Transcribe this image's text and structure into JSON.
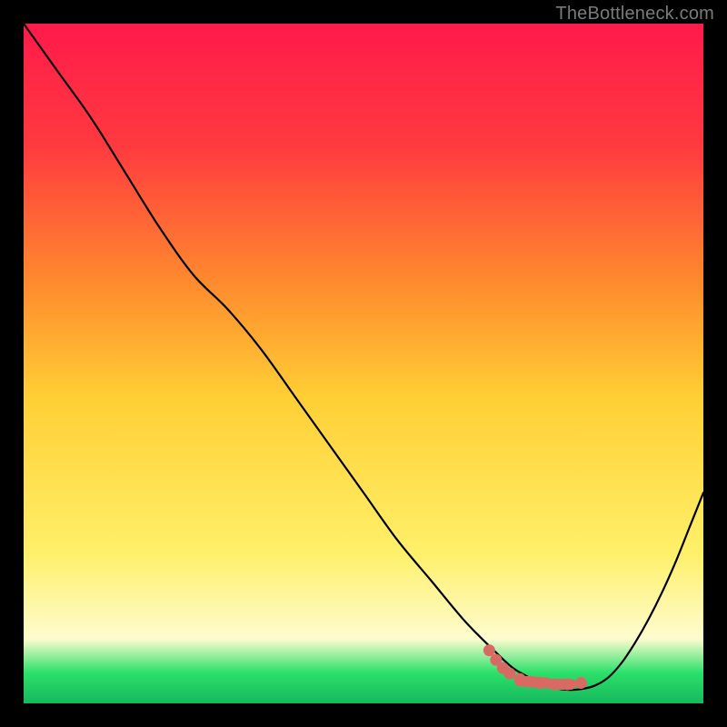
{
  "watermark": "TheBottleneck.com",
  "colors": {
    "grad_top": "#ff1a4b",
    "grad_mid_upper": "#ff7a33",
    "grad_mid": "#ffd23a",
    "grad_mid_lower": "#fff06a",
    "grad_band_pale": "#fefccf",
    "grad_band_green": "#2ce06a",
    "curve": "#000000",
    "marker": "#d86a63",
    "border": "#000000"
  },
  "chart_data": {
    "type": "line",
    "title": "",
    "xlabel": "",
    "ylabel": "",
    "xlim": [
      0,
      100
    ],
    "ylim": [
      0,
      100
    ],
    "series": [
      {
        "name": "curve",
        "x": [
          0,
          5,
          10,
          15,
          20,
          25,
          30,
          35,
          40,
          45,
          50,
          55,
          60,
          65,
          70,
          72,
          74,
          76,
          78,
          80,
          82,
          84,
          86,
          88,
          90,
          92,
          94,
          96,
          98,
          100
        ],
        "y": [
          100,
          93,
          86,
          78,
          70,
          63,
          58,
          52,
          45,
          38,
          31,
          24,
          18,
          12,
          7,
          5.2,
          4.0,
          3.0,
          2.3,
          2.0,
          2.1,
          2.6,
          3.8,
          6.0,
          9.0,
          12.5,
          16.5,
          21.0,
          26.0,
          31.0
        ]
      }
    ],
    "markers": {
      "name": "near-bottom-cluster",
      "points": [
        {
          "x": 68.5,
          "y": 7.8
        },
        {
          "x": 69.5,
          "y": 6.4
        },
        {
          "x": 70.5,
          "y": 5.2
        },
        {
          "x": 71.5,
          "y": 4.4
        },
        {
          "x": 73.0,
          "y": 3.6
        },
        {
          "x": 74.5,
          "y": 3.2
        },
        {
          "x": 76.0,
          "y": 3.0
        },
        {
          "x": 78.0,
          "y": 2.8
        },
        {
          "x": 80.0,
          "y": 2.8
        },
        {
          "x": 82.0,
          "y": 3.0
        }
      ]
    },
    "gradient_stops": [
      {
        "offset": 0.0,
        "color": "#ff1a4b"
      },
      {
        "offset": 0.18,
        "color": "#ff3a3f"
      },
      {
        "offset": 0.38,
        "color": "#ff8a2e"
      },
      {
        "offset": 0.55,
        "color": "#ffcf35"
      },
      {
        "offset": 0.78,
        "color": "#fff06a"
      },
      {
        "offset": 0.905,
        "color": "#fefccf"
      },
      {
        "offset": 0.955,
        "color": "#2ce06a"
      },
      {
        "offset": 1.0,
        "color": "#17b85c"
      }
    ]
  }
}
